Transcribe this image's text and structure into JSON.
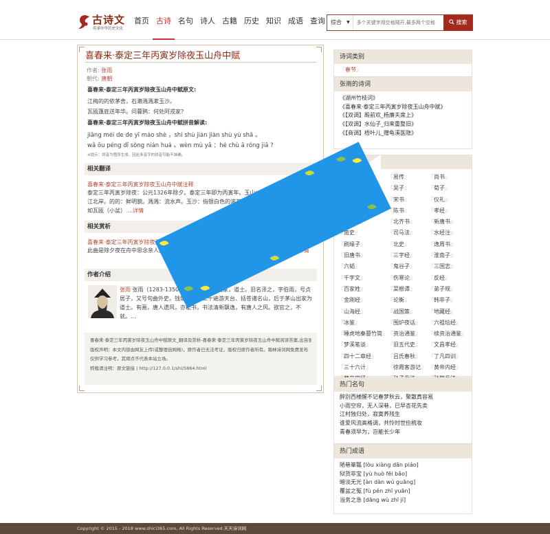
{
  "header": {
    "logo_title": "古诗文",
    "logo_subtitle": "传承中华历史文化",
    "nav": [
      "首页",
      "古诗",
      "名句",
      "诗人",
      "古籍",
      "历史",
      "知识",
      "成语",
      "查询"
    ],
    "nav_active_index": 1,
    "search": {
      "select_value": "综合",
      "placeholder": "多个关键字用空格隔开,最多两个空格",
      "button_label": "搜索"
    }
  },
  "article": {
    "title": "喜春来·泰定三年丙寅岁除夜玉山舟中赋",
    "author_label": "作者:",
    "author": "张雨",
    "dynasty_label": "朝代:",
    "dynasty": "唐朝",
    "original_heading": "喜春来·泰定三年丙寅岁除夜玉山舟中赋原文:",
    "original_lines": [
      "江梅的的依茅舍，石濑溅溅漱玉沙。",
      "瓦瓯篷底送年华。问暮鸦：何处阿戎家?"
    ],
    "pinyin_heading": "喜春来·泰定三年丙寅岁除夜玉山舟中赋拼音解读:",
    "pinyin_lines": [
      "jiāng méi de de yī máo shè ，shí shù jiàn jiàn shù yù shā 。",
      "wǎ ōu péng dǐ sòng nián huá 。wèn mù yā ：hé chù ā róng jiā ?"
    ],
    "pinyin_note": "※提示：拼音为程序生成，因此多音字的拼音可能不准确。",
    "translation_heading": "相关翻译",
    "translation_link": "喜春来·泰定三年丙寅岁除夜玉山舟中赋注释",
    "translation_text": "泰定三年丙寅岁除夜：公元1326年除夕。泰定三年即为丙寅年。玉山：今江西玉山县，在长江北岸。的的：鲜明貌。溅溅：流水声。玉沙：指银白色的滚石。瓦瓯篷：一种简陋的船，形如瓦瓯（小盆）",
    "more_label": "...详情",
    "appreciation_heading": "相关赏析",
    "appreciation_link": "喜春来·泰定三年丙寅岁除夜玉山舟中赋赏析",
    "appreciation_text": "此曲是除夕夜在舟中思念亲人而作。“每逢佳节倍思亲”，流露出作者深切无限亲情。",
    "author_heading": "作者介绍",
    "author_intro_name": "张雨",
    "author_intro_text": "张雨（1283-1350）元代诗人、词曲家，道士。旧名泽之，字伯雨，号贞居子，又号句曲外史。钱塘人。年二十遍游天台、括苍诸名山，后于茅山出家为道士。有画，唐人遗风，亦能书，书法清新飘逸，有唐人之风。欲官之，不就。...",
    "copyright_lines": [
      "喜春来·泰定三年丙寅岁除夜玉山舟中赋原文_翻译及赏析-喜春来·泰定三年丙寅岁除夜玉山舟中赋阅读答案,出自张雨的作品",
      "版权声明：本文内容由网友上传(或整理自网络)，原作者已无法考证，版权归原作者所有。翰林诗词网免费发布仅供学习参考，其观点不代表本站立场。",
      "转载请注明：原文链接 | http://127.0.0.1/shi/5864.html"
    ]
  },
  "sidebar": {
    "categories": {
      "title": "诗词类别",
      "items": [
        "春节"
      ]
    },
    "author_poems": {
      "title": "张雨的诗词",
      "items": [
        "《湖州竹枝词》",
        "《喜春来·泰定三年丙寅岁除夜玉山舟中赋》",
        "《【双调】殿前欢_杨廉夫席上》",
        "《【双调】水仙子_归来重整旧》",
        "《【商调】梧叶儿_赠龟溪医隐》"
      ]
    },
    "books": {
      "title": "古文典籍",
      "items": [
        "周易",
        "易传",
        "尚书",
        "礼记",
        "吴子",
        "荀子",
        "列子",
        "宋书",
        "仪礼",
        "周书",
        "陈书",
        "孝经",
        "南齐书",
        "北齐书",
        "新唐书",
        "南史",
        "司马法",
        "水经注",
        "刷缘子",
        "北史",
        "逸周书",
        "旧唐书",
        "三字经",
        "淮南子",
        "六韬",
        "鬼谷子",
        "三国志",
        "千字文",
        "伤寒论",
        "反经",
        "百家姓",
        "菜根谭",
        "弟子规",
        "金刚经",
        "论衡",
        "韩非子",
        "山海经",
        "战国策",
        "地藏经",
        "冰鉴",
        "围炉夜话",
        "六祖坛经",
        "睡虎地秦墓竹简",
        "资治通鉴",
        "续资治通鉴",
        "梦溪笔谈",
        "旧五代史",
        "文昌孝经",
        "四十二章经",
        "吕氏春秋",
        "了凡四训",
        "三十六计",
        "徐霞客游记",
        "黄帝内经",
        "黄帝四经",
        "孙子兵法",
        "孙膑兵法",
        "本草纲目",
        "孔子家语",
        "世说新语",
        "贞观政要",
        "颜氏家训",
        "容斋随笔",
        "文心雕龙",
        "农桑辑要"
      ]
    },
    "famous_lines": {
      "title": "热门名句",
      "items": [
        "醉别西楼醒不记春梦秋云，聚散真容易",
        "小雨空帘，无人深巷，已早杏花先卖",
        "江村独归处，寂寞养残生",
        "谁爱风流高格调，共怜时世俭梳妆",
        "青春须早为，岂能长少年"
      ]
    },
    "idioms": {
      "title": "热门成语",
      "items": [
        "陋巷箪瓢 [lòu xiàng dān piáo]",
        "狱货非宝 [yù huò fēi bǎo]",
        "暗淡无光 [àn dàn wú guāng]",
        "覆盆之冤 [fù pén zhī yuān]",
        "当务之急 [dāng wù zhī jí]"
      ]
    }
  },
  "footer": {
    "text": "Copyright © 2015 - 2018 www.shici365.com, All Rights Reserved.天天诗词网"
  },
  "colors": {
    "accent": "#a42a1d",
    "title_red": "#8c2a14",
    "link_red": "#b54a3a",
    "ad_blue": "#2196e8",
    "footer_bg": "#5e4a3c"
  }
}
